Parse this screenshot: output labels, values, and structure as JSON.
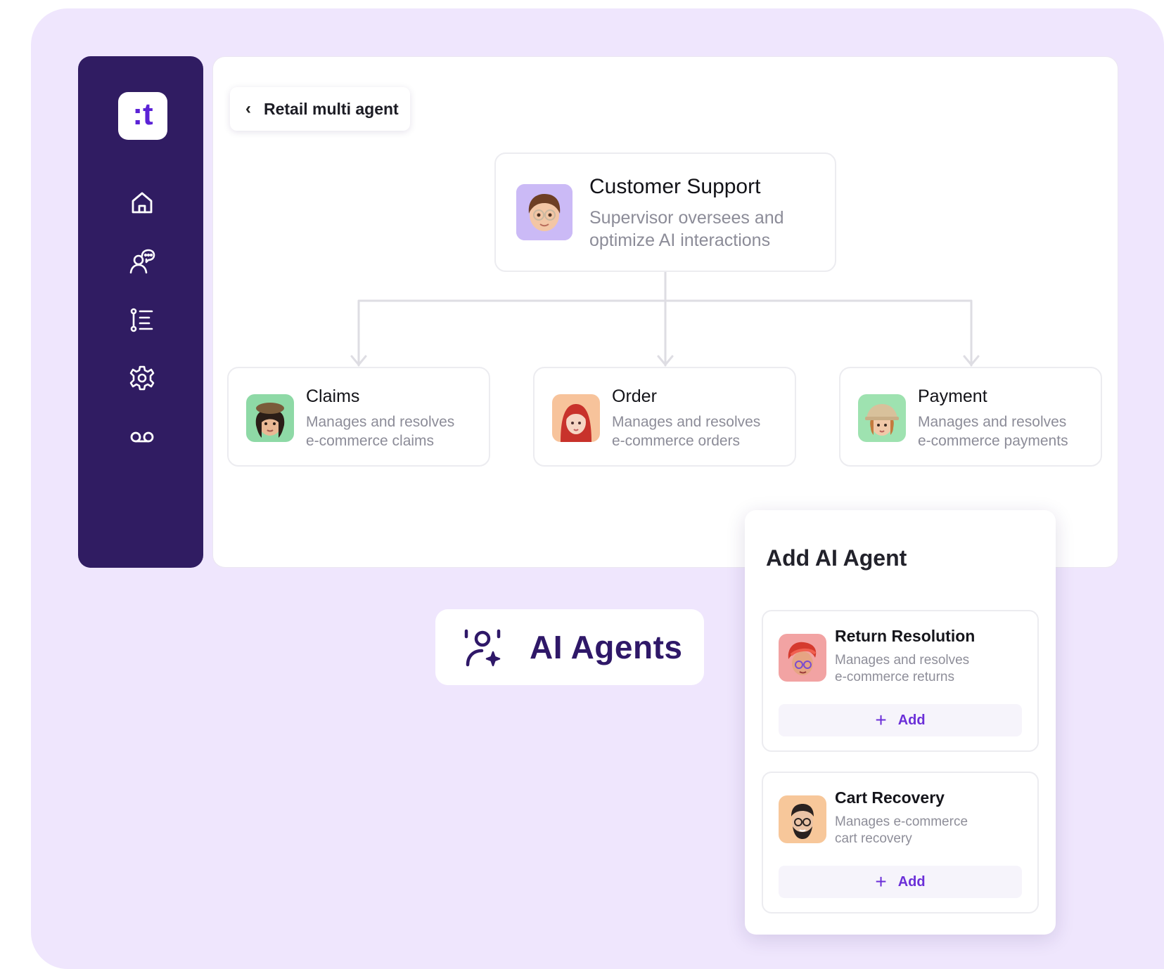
{
  "app": {
    "logo_text": ":t"
  },
  "sidebar": {
    "items": [
      {
        "id": "home",
        "icon": "home-icon"
      },
      {
        "id": "conversations",
        "icon": "chat-user-icon"
      },
      {
        "id": "flows",
        "icon": "list-flow-icon"
      },
      {
        "id": "settings",
        "icon": "gear-icon"
      },
      {
        "id": "voicemail",
        "icon": "voicemail-icon"
      }
    ]
  },
  "header": {
    "back_label": "Retail multi agent"
  },
  "supervisor": {
    "title": "Customer Support",
    "desc_line1": "Supervisor oversees and",
    "desc_line2": "optimize AI interactions"
  },
  "agents": [
    {
      "title": "Claims",
      "desc_line1": "Manages and resolves",
      "desc_line2": "e-commerce claims"
    },
    {
      "title": "Order",
      "desc_line1": "Manages and resolves",
      "desc_line2": "e-commerce orders"
    },
    {
      "title": "Payment",
      "desc_line1": "Manages and resolves",
      "desc_line2": "e-commerce payments"
    }
  ],
  "badge": {
    "label": "AI Agents",
    "icon": "ai-agent-icon"
  },
  "add_panel": {
    "title": "Add AI Agent",
    "cards": [
      {
        "title": "Return Resolution",
        "desc_line1": "Manages and resolves",
        "desc_line2": "e-commerce returns",
        "button": "Add"
      },
      {
        "title": "Cart Recovery",
        "desc_line1": "Manages e-commerce",
        "desc_line2": "cart recovery",
        "button": "Add"
      }
    ]
  },
  "colors": {
    "background": "#efe6fd",
    "sidebar": "#301c62",
    "accent": "#6b2fd8"
  }
}
